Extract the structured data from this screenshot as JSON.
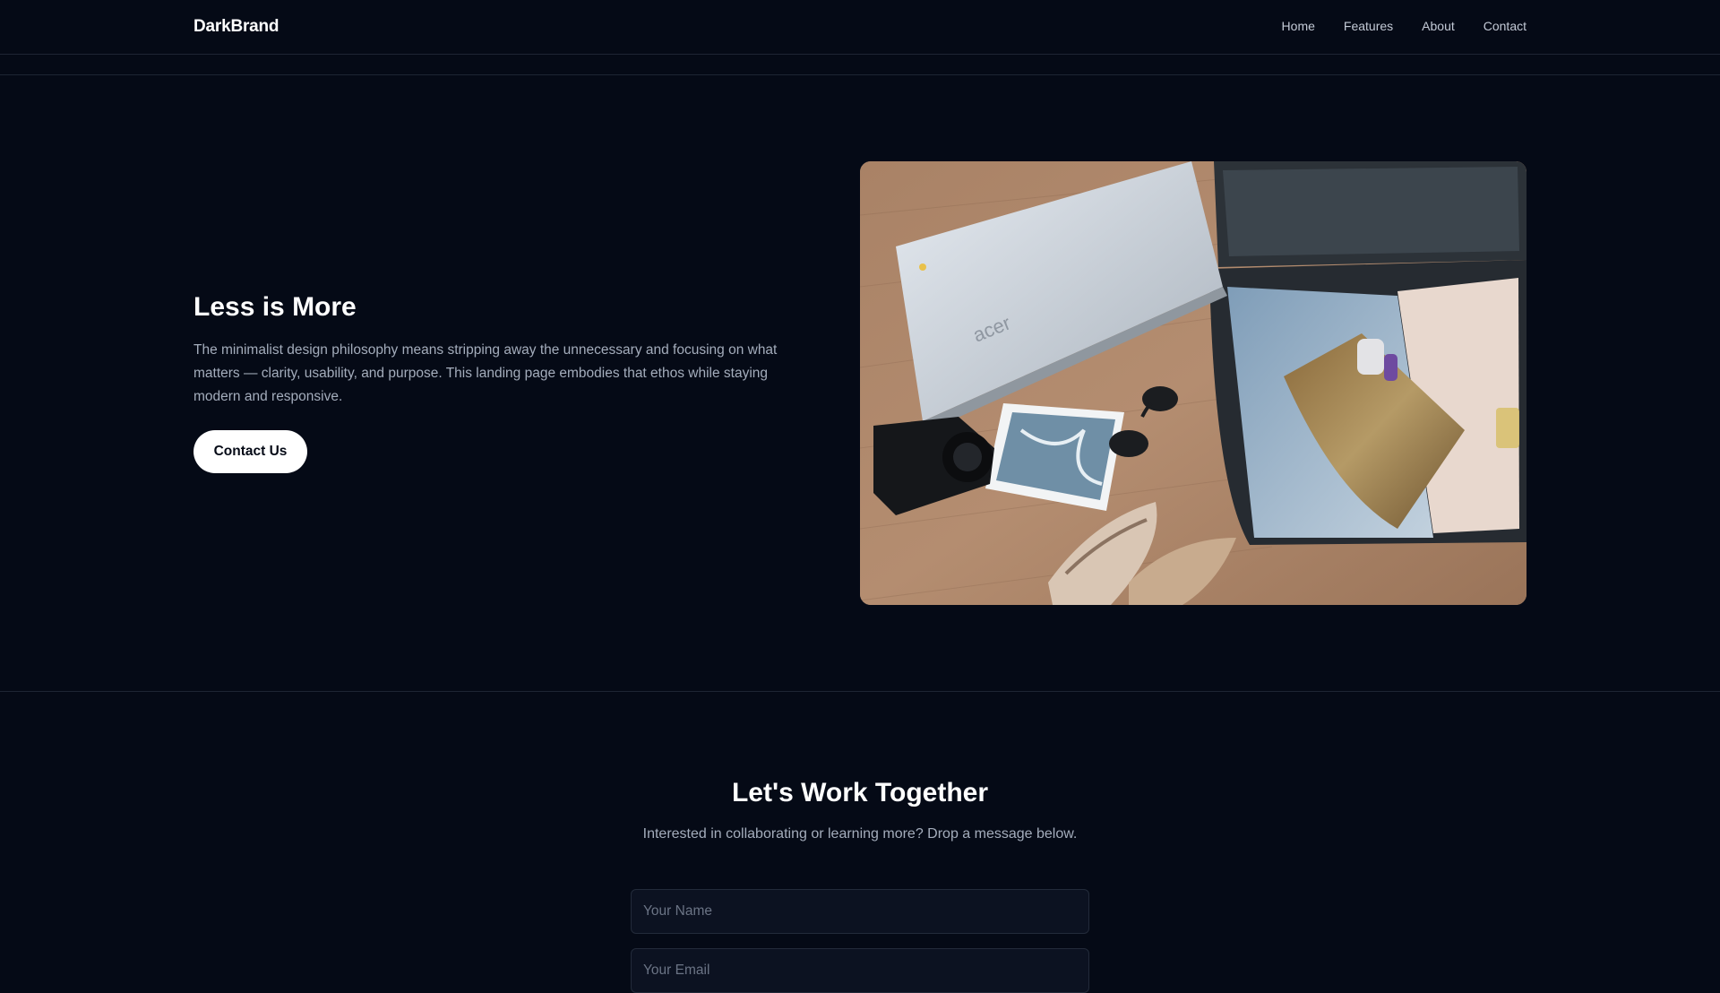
{
  "brand": {
    "name": "DarkBrand"
  },
  "nav": {
    "links": [
      {
        "label": "Home"
      },
      {
        "label": "Features"
      },
      {
        "label": "About"
      },
      {
        "label": "Contact"
      }
    ]
  },
  "hero": {
    "title": "Less is More",
    "text": "The minimalist design philosophy means stripping away the unnecessary and focusing on what matters — clarity, usability, and purpose. This landing page embodies that ethos while staying modern and responsive.",
    "cta_label": "Contact Us",
    "image_laptop_logo": "acer"
  },
  "contact": {
    "title": "Let's Work Together",
    "subtitle": "Interested in collaborating or learning more? Drop a message below.",
    "name_placeholder": "Your Name",
    "email_placeholder": "Your Email"
  },
  "colors": {
    "background": "#050a16",
    "divider": "#1e2533",
    "field_background": "#0c1221",
    "button_background": "#ffffff"
  }
}
